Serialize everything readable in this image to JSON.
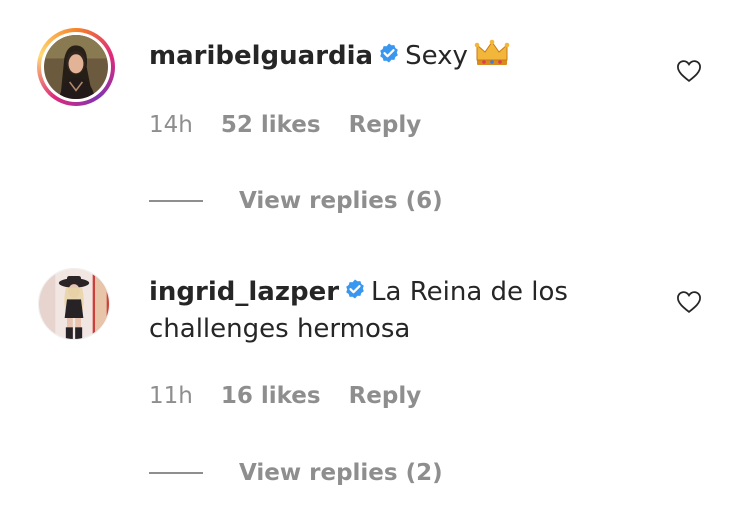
{
  "comments": [
    {
      "username": "maribelguardia",
      "verified": true,
      "text": "Sexy",
      "emoji": "crown-icon",
      "time": "14h",
      "likes": "52 likes",
      "reply": "Reply",
      "view_replies": "View replies (6)"
    },
    {
      "username": "ingrid_lazper",
      "verified": true,
      "text": "La Reina de los challenges hermosa",
      "time": "11h",
      "likes": "16 likes",
      "reply": "Reply",
      "view_replies": "View replies (2)"
    }
  ],
  "colors": {
    "text": "#262626",
    "secondary": "#8e8e8e",
    "verified": "#3897f0"
  }
}
